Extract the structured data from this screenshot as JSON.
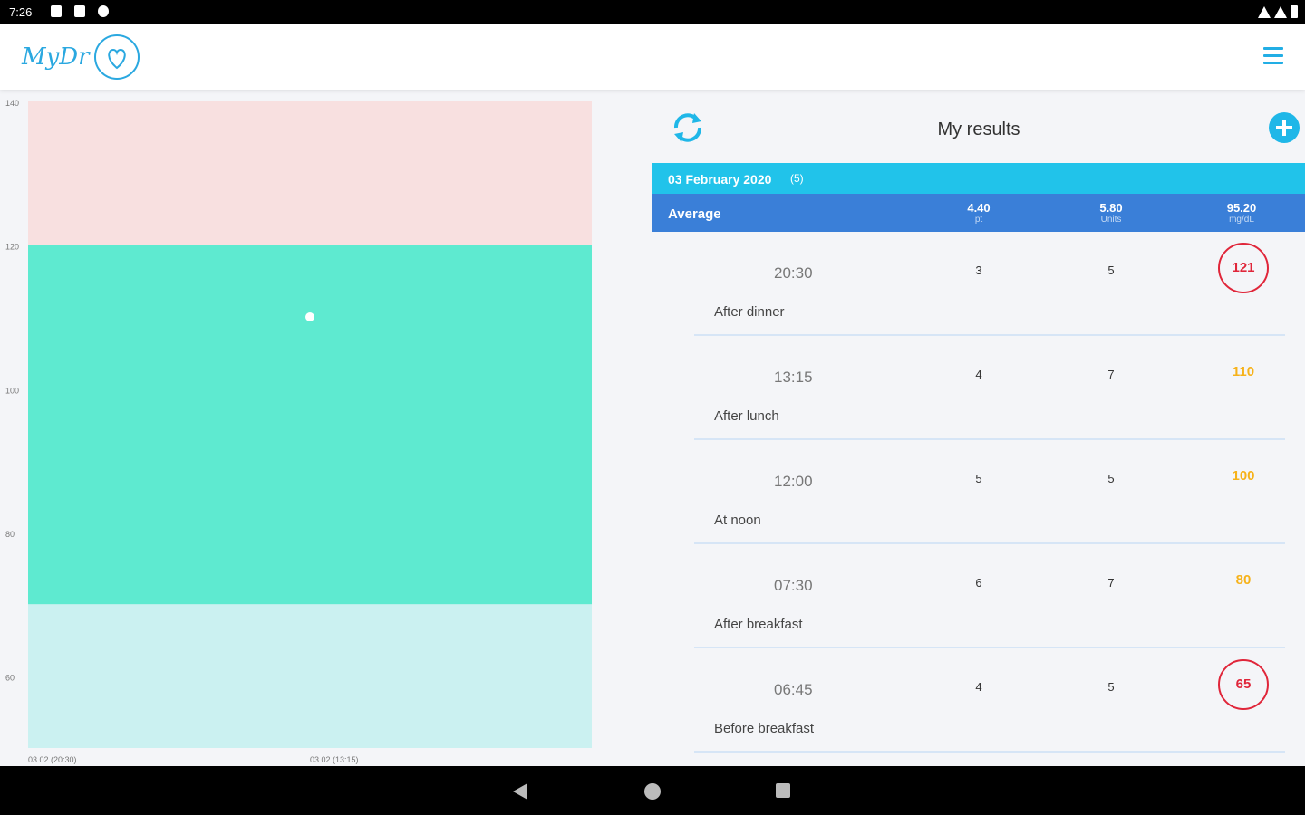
{
  "status_bar": {
    "time": "7:26"
  },
  "app": {
    "logo_text": "MyDr",
    "menu_icon": "hamburger-menu-icon",
    "accent_color": "#22aee5"
  },
  "chart_data": {
    "type": "scatter",
    "title": "",
    "xlabel": "",
    "ylabel": "",
    "ylim": [
      50,
      140
    ],
    "y_ticks": [
      140,
      120,
      100,
      80,
      60
    ],
    "x_tick_labels": [
      "03.02 (20:30)",
      "03.02 (13:15)"
    ],
    "bands": [
      {
        "from": 120,
        "to": 140,
        "color": "#f8e0e0"
      },
      {
        "from": 70,
        "to": 120,
        "color": "#5eead0"
      },
      {
        "from": 50,
        "to": 70,
        "color": "#cbf1f1"
      }
    ],
    "points": [
      {
        "x": "03.02 (13:15)",
        "y": 110
      }
    ]
  },
  "results": {
    "title": "My results",
    "refresh_icon": "refresh-icon",
    "add_icon": "add-circle-icon",
    "date": "03 February 2020",
    "count": "(5)",
    "average": {
      "label": "Average",
      "cols": [
        {
          "value": "4.40",
          "unit": "pt"
        },
        {
          "value": "5.80",
          "unit": "Units"
        },
        {
          "value": "95.20",
          "unit": "mg/dL"
        }
      ]
    },
    "rows": [
      {
        "time": "20:30",
        "label": "After dinner",
        "c1": "3",
        "c2": "5",
        "value": "121",
        "status": "alert"
      },
      {
        "time": "13:15",
        "label": "After lunch",
        "c1": "4",
        "c2": "7",
        "value": "110",
        "status": "warn"
      },
      {
        "time": "12:00",
        "label": "At noon",
        "c1": "5",
        "c2": "5",
        "value": "100",
        "status": "warn"
      },
      {
        "time": "07:30",
        "label": "After breakfast",
        "c1": "6",
        "c2": "7",
        "value": "80",
        "status": "warn"
      },
      {
        "time": "06:45",
        "label": "Before breakfast",
        "c1": "4",
        "c2": "5",
        "value": "65",
        "status": "alert"
      }
    ]
  },
  "colors": {
    "alert": "#e0263a",
    "warn": "#f6b21a",
    "date_band": "#21c3ea",
    "avg_band": "#3a7fd8"
  }
}
